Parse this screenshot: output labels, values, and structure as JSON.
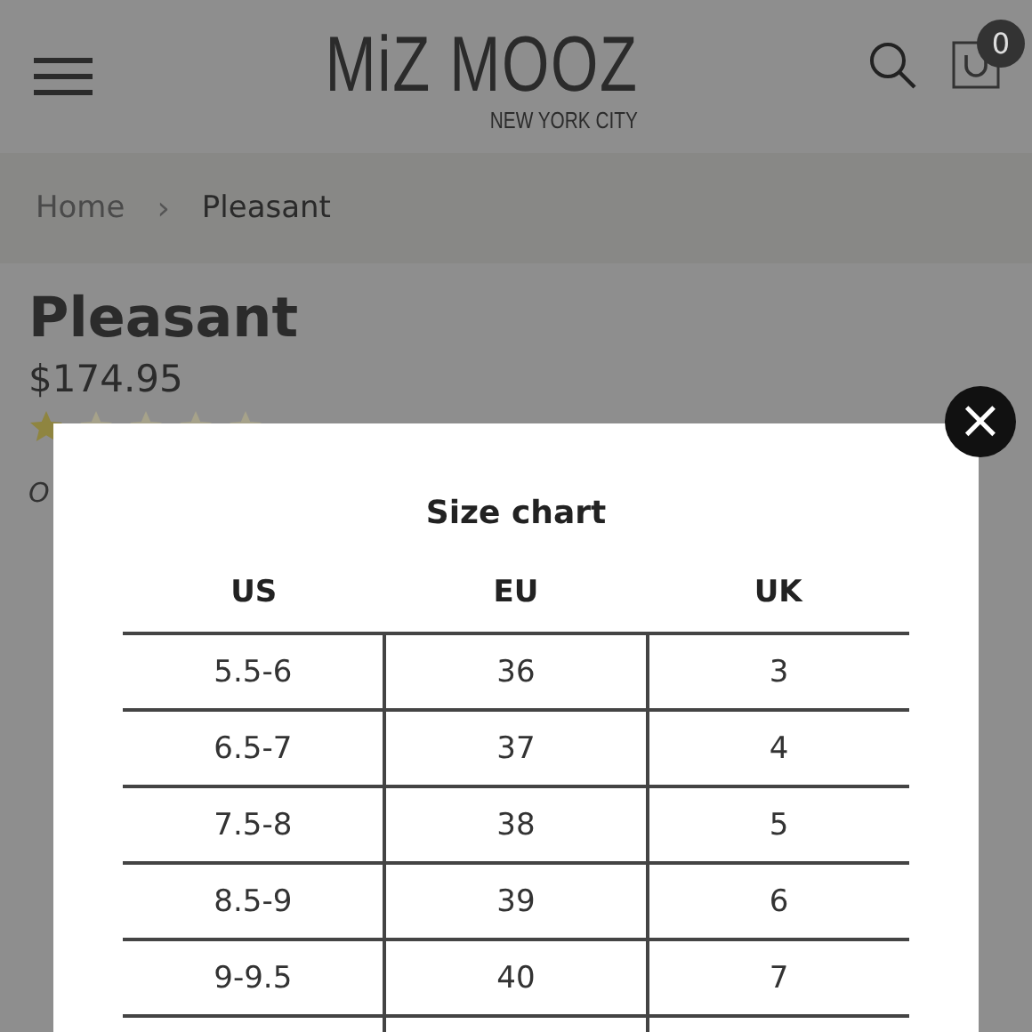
{
  "header": {
    "logo": "MiZ MOOZ",
    "logo_subtitle": "NEW YORK CITY",
    "cart_count": "0"
  },
  "breadcrumb": [
    "Home",
    "›",
    "Pleasant"
  ],
  "product": {
    "title": "Pleasant",
    "price": "$174.95",
    "stars": 1,
    "note": "O"
  },
  "size_chart": {
    "title": "Size chart",
    "close": "×",
    "columns": [
      "US",
      "EU",
      "UK"
    ],
    "rows": [
      [
        "5.5-6",
        "36",
        "3"
      ],
      [
        "6.5-7",
        "37",
        "4"
      ],
      [
        "7.5-8",
        "38",
        "5"
      ],
      [
        "8.5-9",
        "39",
        "6"
      ],
      [
        "9-9.5",
        "40",
        "7"
      ]
    ]
  }
}
